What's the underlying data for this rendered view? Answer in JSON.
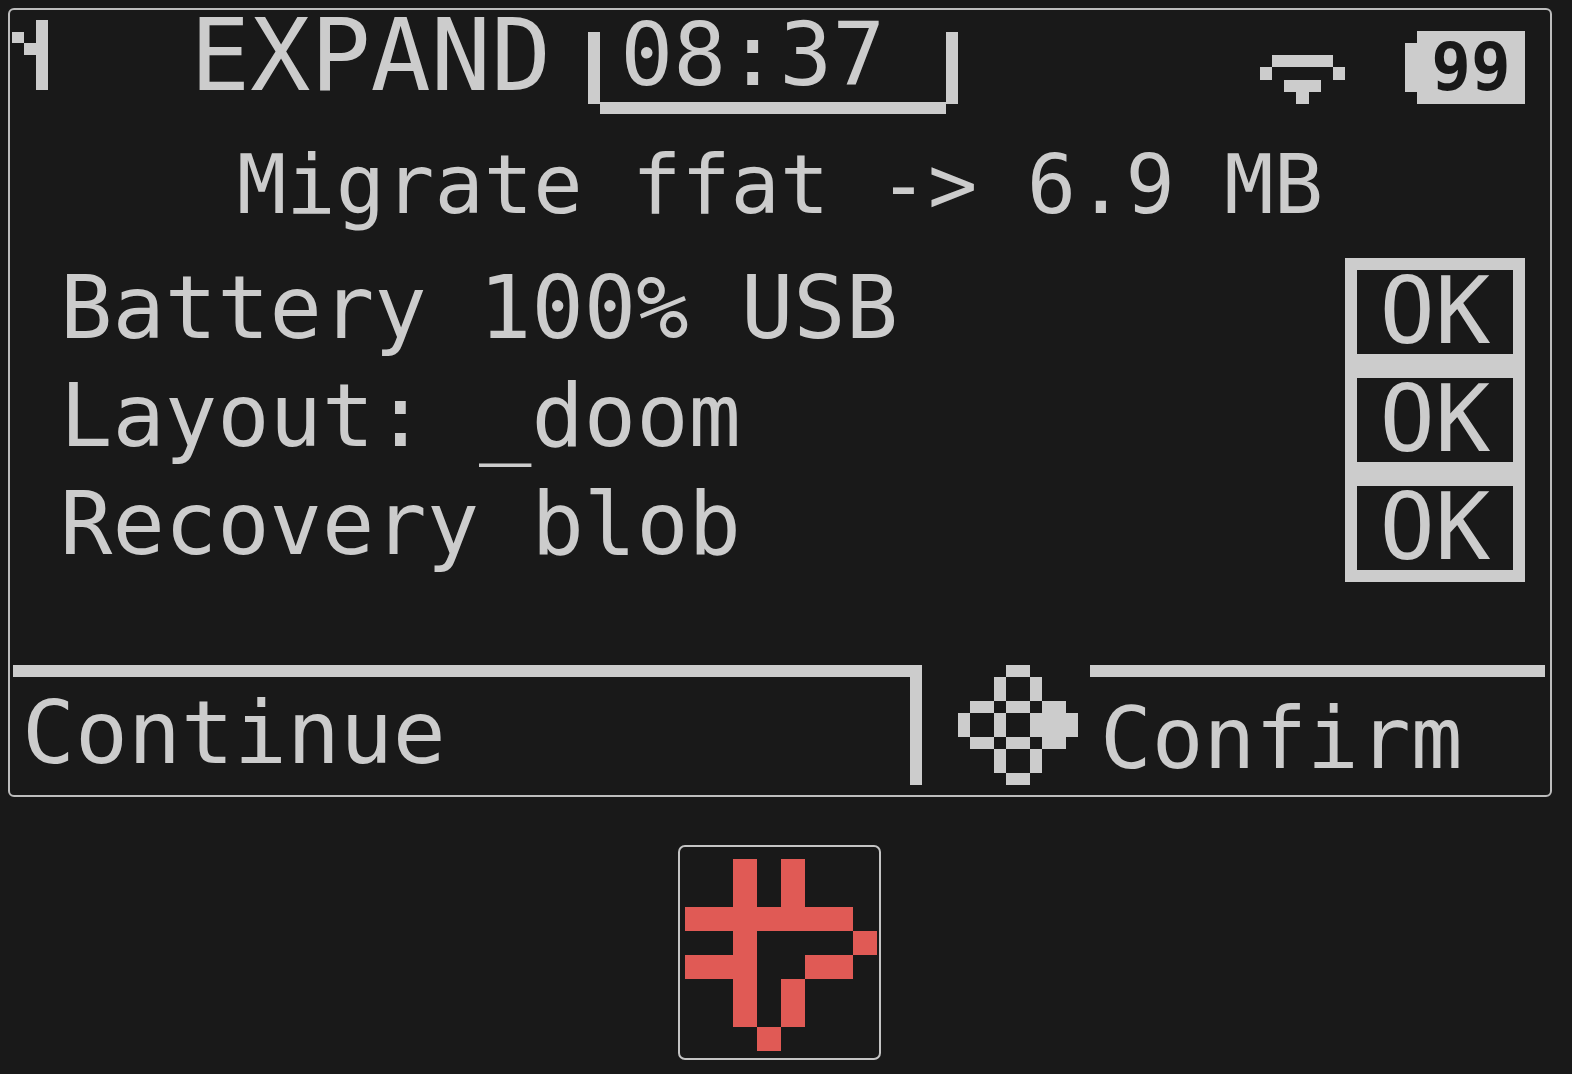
{
  "status_bar": {
    "mode": "EXPAND",
    "time": "08:37",
    "battery": "99"
  },
  "title": "Migrate ffat -> 6.9 MB",
  "checks": [
    {
      "label": "Battery 100% USB",
      "status": "OK"
    },
    {
      "label": "Layout: _doom",
      "status": "OK"
    },
    {
      "label": "Recovery blob",
      "status": "OK"
    }
  ],
  "soft_keys": {
    "left": "Continue",
    "right": "Confirm"
  }
}
